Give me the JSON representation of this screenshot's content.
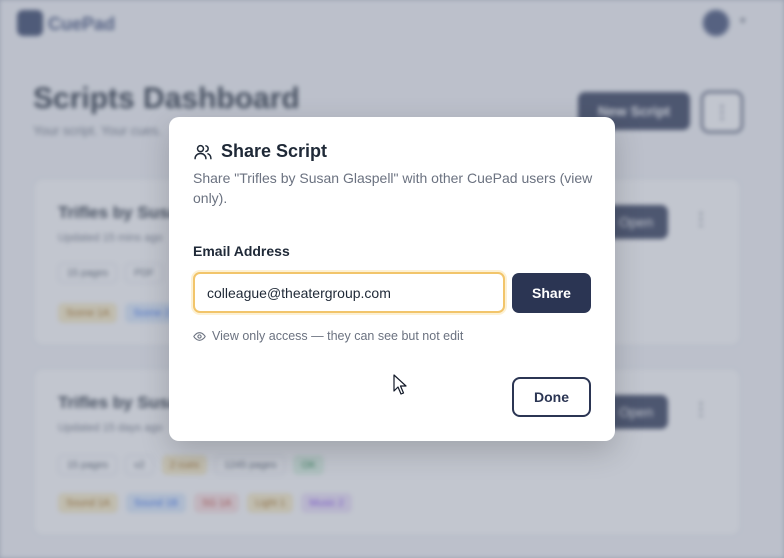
{
  "app": {
    "logo_text": "CuePad",
    "page_title": "Scripts Dashboard",
    "page_subtitle": "Your script. Your cues.",
    "new_script_label": "New Script",
    "more_label": "⋮"
  },
  "cards": [
    {
      "title": "Trifles by Susan Glaspell",
      "meta": "Updated 15 mins ago",
      "open_label": "Open",
      "chips": [
        "15 pages",
        "PDF"
      ],
      "tags": [
        {
          "label": "Scene 1A",
          "color": "yellow"
        },
        {
          "label": "Scene 2",
          "color": "blue"
        }
      ]
    },
    {
      "title": "Trifles by Susan Glaspell",
      "meta": "Updated 15 days ago",
      "open_label": "Open",
      "chips": [
        "15 pages",
        "v2"
      ],
      "tags_row1": [
        {
          "label": "2 cues",
          "color": "yellow"
        },
        {
          "label": "1245 pages",
          "color": "plain"
        },
        {
          "label": "OK",
          "color": "green"
        }
      ],
      "tags_row2": [
        {
          "label": "Sound 1A",
          "color": "yellow"
        },
        {
          "label": "Sound 1B",
          "color": "blue"
        },
        {
          "label": "SG 1A",
          "color": "red"
        },
        {
          "label": "Light 1",
          "color": "yellow"
        },
        {
          "label": "Music 2",
          "color": "purple"
        }
      ]
    }
  ],
  "modal": {
    "title": "Share Script",
    "title_icon": "users-icon",
    "description": "Share \"Trifles by Susan Glaspell\" with other CuePad users (view only).",
    "email_label": "Email Address",
    "email_value": "colleague@theatergroup.com",
    "share_label": "Share",
    "hint_icon": "eye-icon",
    "hint_text": "View only access — they can see but not edit",
    "done_label": "Done"
  },
  "colors": {
    "primary": "#2b3553",
    "focus_ring": "#f2c56b",
    "muted_text": "#6b7280"
  }
}
